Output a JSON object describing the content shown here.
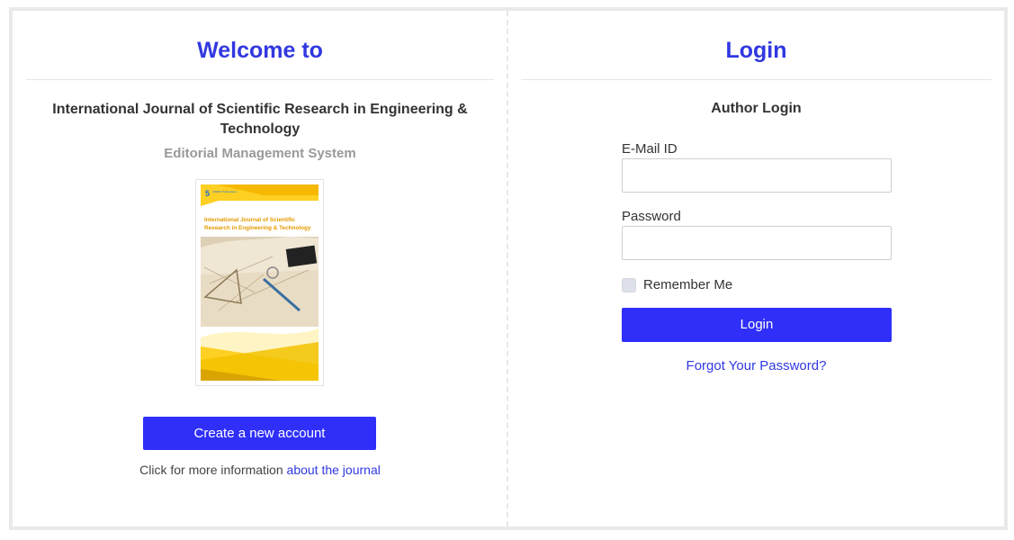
{
  "left": {
    "heading": "Welcome to",
    "journal_title": "International Journal of Scientific Research in Engineering & Technology",
    "subtitle": "Editorial Management System",
    "cover": {
      "publisher_mark": "5",
      "publisher_name": "IJSRET Publications",
      "title": "International Journal of Scientific Research in Engineering & Technology",
      "accent_color": "#ffd024"
    },
    "create_account_label": "Create a new account",
    "info_prefix": "Click for more information",
    "info_link": "about the journal"
  },
  "right": {
    "heading": "Login",
    "section_title": "Author Login",
    "email_label": "E-Mail ID",
    "email_value": "",
    "password_label": "Password",
    "password_value": "",
    "remember_label": "Remember Me",
    "login_label": "Login",
    "forgot_label": "Forgot Your Password?"
  },
  "colors": {
    "brand": "#3138e0",
    "button": "#2f2ff9"
  }
}
